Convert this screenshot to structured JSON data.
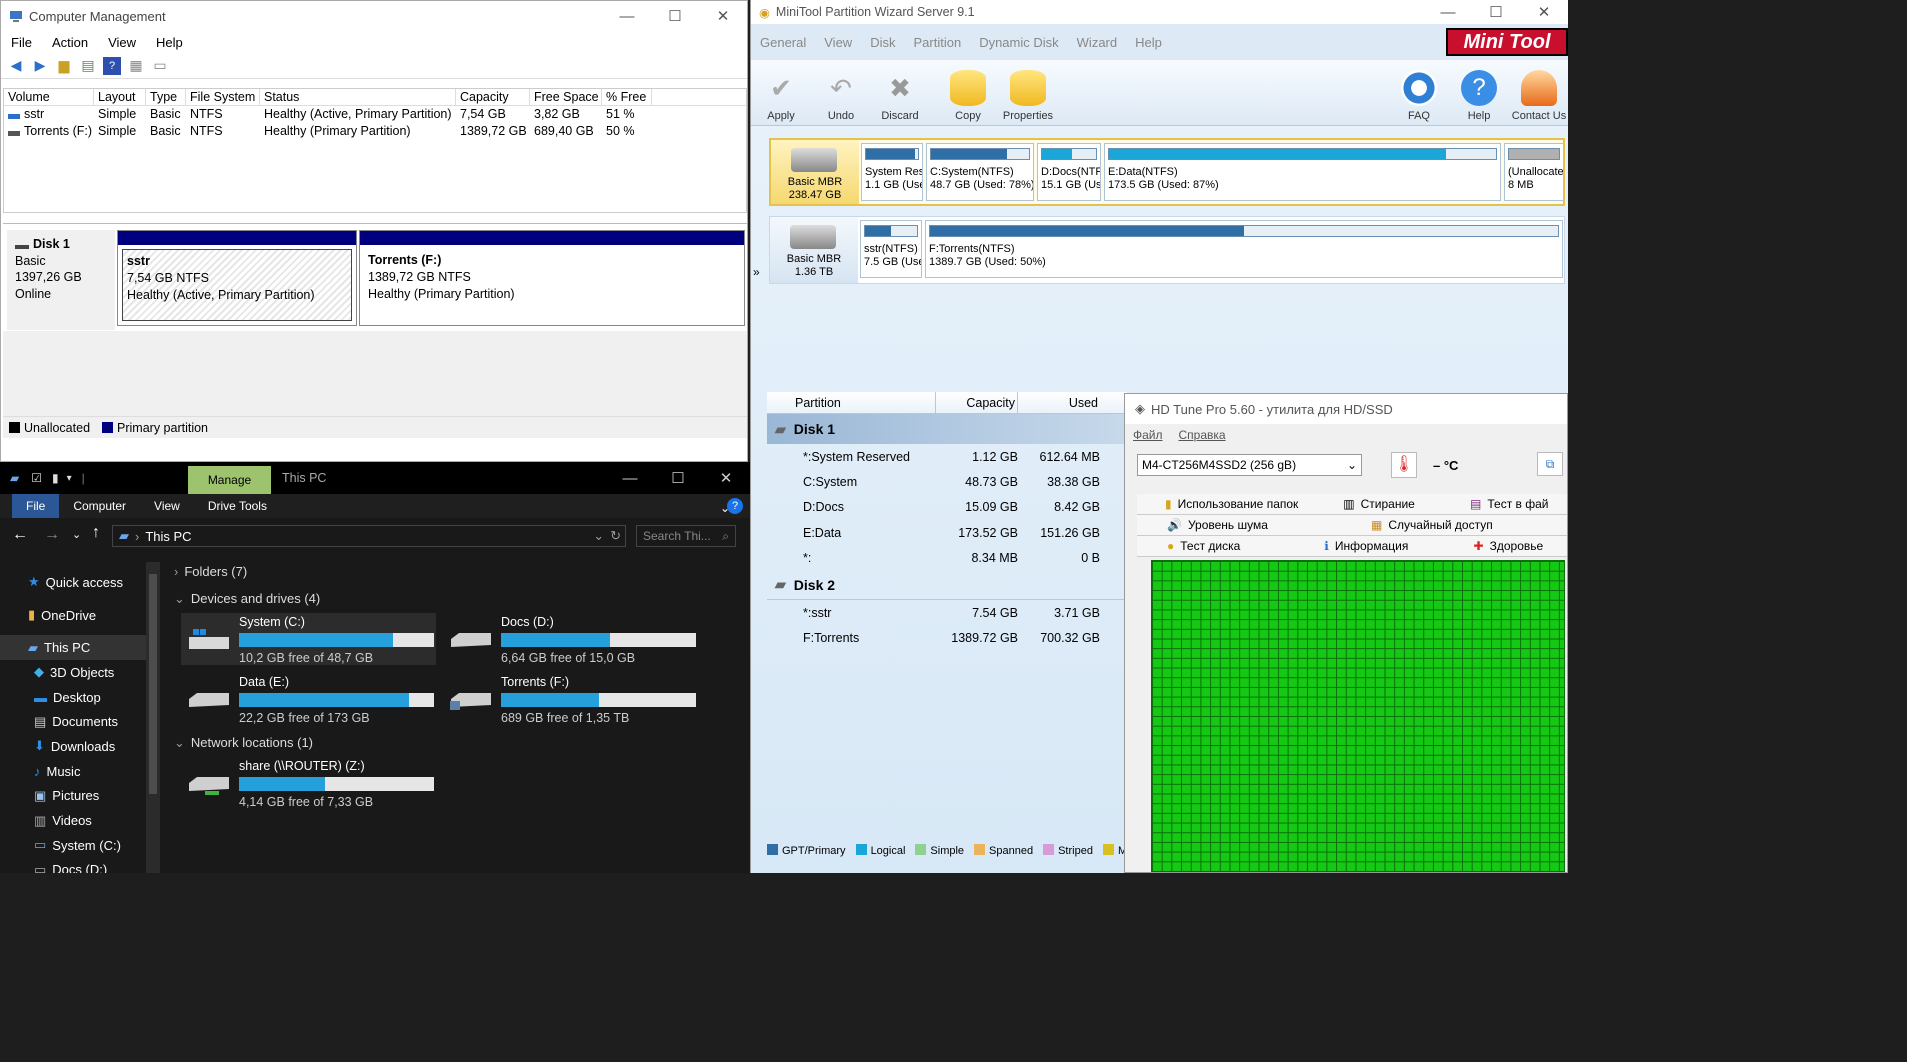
{
  "cm": {
    "title": "Computer Management",
    "menu": [
      "File",
      "Action",
      "View",
      "Help"
    ],
    "columns": [
      "Volume",
      "Layout",
      "Type",
      "File System",
      "Status",
      "Capacity",
      "Free Space",
      "% Free"
    ],
    "rows": [
      [
        "sstr",
        "Simple",
        "Basic",
        "NTFS",
        "Healthy (Active, Primary Partition)",
        "7,54 GB",
        "3,82 GB",
        "51 %"
      ],
      [
        "Torrents (F:)",
        "Simple",
        "Basic",
        "NTFS",
        "Healthy (Primary Partition)",
        "1389,72 GB",
        "689,40 GB",
        "50 %"
      ]
    ],
    "disk": {
      "name": "Disk 1",
      "type": "Basic",
      "size": "1397,26 GB",
      "status": "Online"
    },
    "parts": [
      {
        "name": "sstr",
        "size": "7,54 GB NTFS",
        "status": "Healthy (Active, Primary Partition)"
      },
      {
        "name": "Torrents  (F:)",
        "size": "1389,72 GB NTFS",
        "status": "Healthy (Primary Partition)"
      }
    ],
    "legend": [
      "Unallocated",
      "Primary partition"
    ],
    "colors": {
      "unallocated": "#000000",
      "primary": "#00007f"
    }
  },
  "ex": {
    "manage": "Manage",
    "title": "This PC",
    "tabs": [
      "File",
      "Computer",
      "View",
      "Drive Tools"
    ],
    "address": "This PC",
    "search": "Search Thi...",
    "nav": [
      "Quick access",
      "OneDrive",
      "This PC",
      "3D Objects",
      "Desktop",
      "Documents",
      "Downloads",
      "Music",
      "Pictures",
      "Videos",
      "System (C:)",
      "Docs (D:)"
    ],
    "folders": "Folders (7)",
    "devices": "Devices and drives (4)",
    "network": "Network locations (1)",
    "drives": [
      {
        "name": "System (C:)",
        "free": "10,2 GB free of 48,7 GB",
        "used": 0.79
      },
      {
        "name": "Docs (D:)",
        "free": "6,64 GB free of 15,0 GB",
        "used": 0.56
      },
      {
        "name": "Data (E:)",
        "free": "22,2 GB free of 173 GB",
        "used": 0.87
      },
      {
        "name": "Torrents (F:)",
        "free": "689 GB free of 1,35 TB",
        "used": 0.5
      },
      {
        "name": "share (\\\\ROUTER) (Z:)",
        "free": "4,14 GB free of 7,33 GB",
        "used": 0.44
      }
    ]
  },
  "mt": {
    "title": "MiniTool Partition Wizard Server 9.1",
    "menu": [
      "General",
      "View",
      "Disk",
      "Partition",
      "Dynamic Disk",
      "Wizard",
      "Help"
    ],
    "logo": "Mini Tool",
    "toolbar": [
      "Apply",
      "Undo",
      "Discard",
      "Copy",
      "Properties",
      "FAQ",
      "Help",
      "Contact Us"
    ],
    "disk1": {
      "label1": "Basic MBR",
      "label2": "238.47 GB"
    },
    "disk2": {
      "label1": "Basic MBR",
      "label2": "1.36 TB"
    },
    "map1": [
      {
        "l1": "System Rese",
        "l2": "1.1 GB (Use",
        "used": 0.95,
        "color": "#2f6fa6"
      },
      {
        "l1": "C:System(NTFS)",
        "l2": "48.7 GB (Used: 78%)",
        "used": 0.78,
        "color": "#2f6fa6"
      },
      {
        "l1": "D:Docs(NTF",
        "l2": "15.1 GB (Us",
        "used": 0.56,
        "color": "#1aa6d6"
      },
      {
        "l1": "E:Data(NTFS)",
        "l2": "173.5 GB (Used: 87%)",
        "used": 0.87,
        "color": "#1aa6d6"
      },
      {
        "l1": "(Unallocatec",
        "l2": "8 MB",
        "used": 1.0,
        "color": "#b0b0b0"
      }
    ],
    "map2": [
      {
        "l1": "sstr(NTFS)",
        "l2": "7.5 GB (Use",
        "used": 0.5,
        "color": "#2f6fa6"
      },
      {
        "l1": "F:Torrents(NTFS)",
        "l2": "1389.7 GB (Used: 50%)",
        "used": 0.5,
        "color": "#2f6fa6"
      }
    ],
    "table_head": [
      "Partition",
      "Capacity",
      "Used"
    ],
    "disk_rows": [
      "Disk 1",
      "Disk 2"
    ],
    "rows1": [
      [
        "*:System Reserved",
        "1.12 GB",
        "612.64 MB"
      ],
      [
        "C:System",
        "48.73 GB",
        "38.38 GB"
      ],
      [
        "D:Docs",
        "15.09 GB",
        "8.42 GB"
      ],
      [
        "E:Data",
        "173.52 GB",
        "151.26 GB"
      ],
      [
        "*:",
        "8.34 MB",
        "0 B"
      ]
    ],
    "rows2": [
      [
        "*:sstr",
        "7.54 GB",
        "3.71 GB"
      ],
      [
        "F:Torrents",
        "1389.72 GB",
        "700.32 GB"
      ]
    ],
    "legend": [
      "GPT/Primary",
      "Logical",
      "Simple",
      "Spanned",
      "Striped",
      "M"
    ]
  },
  "hd": {
    "title": "HD Tune Pro 5.60 - утилита для HD/SSD",
    "menu": [
      "Файл",
      "Справка"
    ],
    "drive": "M4-CT256M4SSD2 (256 gB)",
    "temp": "– °C",
    "tabs1": [
      "Использование папок",
      "Стирание",
      "Тест в фай"
    ],
    "tabs2": [
      "Уровень шума",
      "Случайный доступ"
    ],
    "tabs3": [
      "Тест диска",
      "Информация",
      "Здоровье"
    ]
  }
}
